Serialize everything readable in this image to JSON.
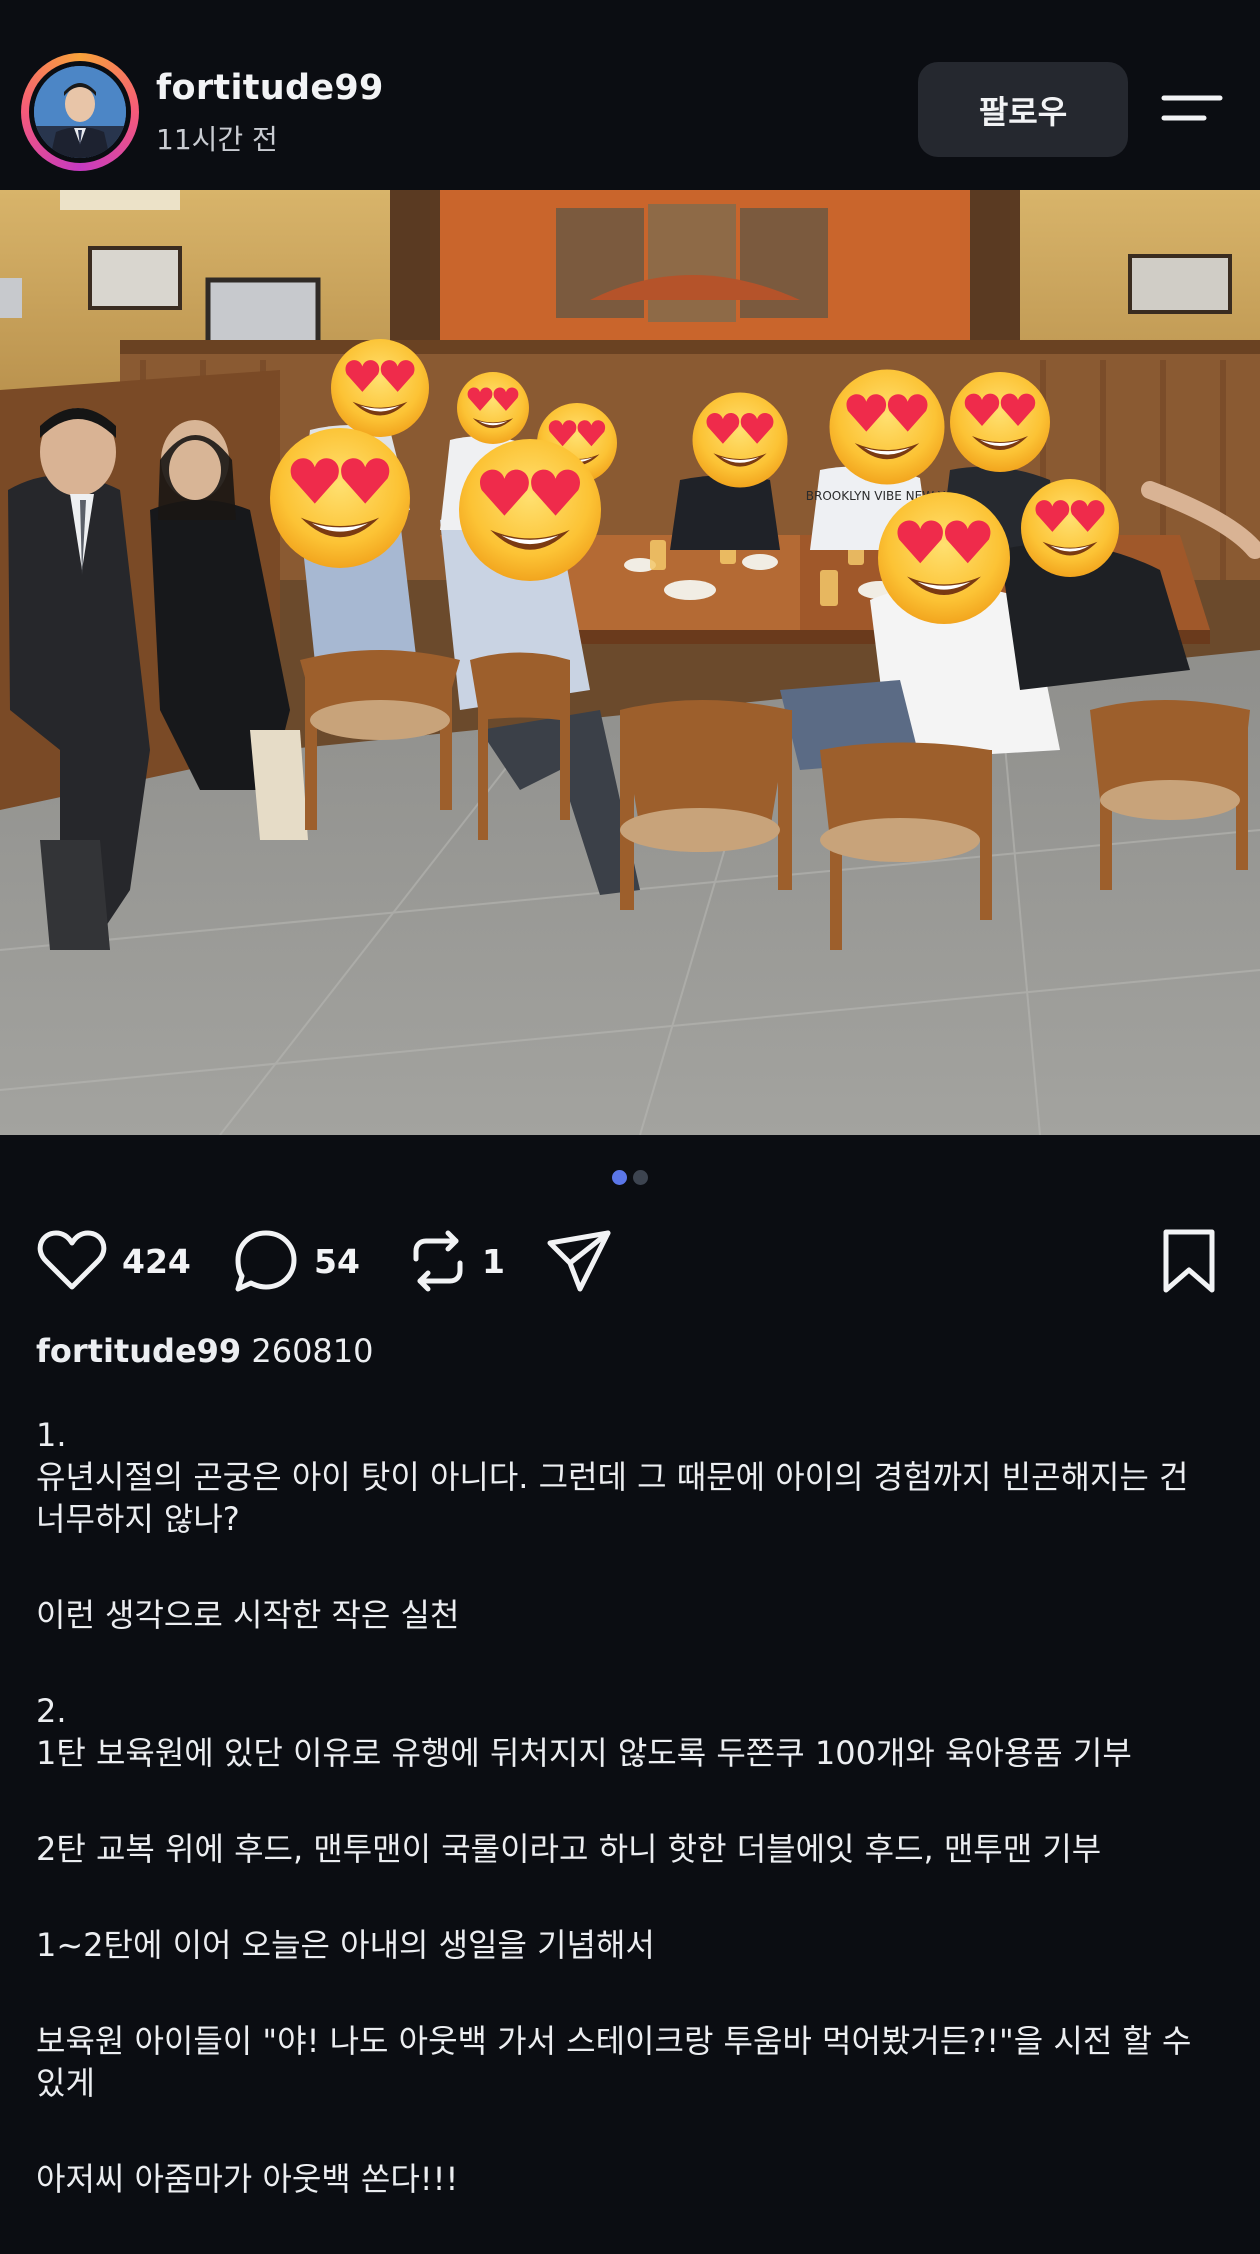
{
  "post": {
    "username": "fortitude99",
    "time_ago": "11시간 전",
    "follow_label": "팔로우"
  },
  "carousel": {
    "total": 2,
    "current": 1
  },
  "actions": {
    "likes": "424",
    "comments": "54",
    "reposts": "1"
  },
  "caption": {
    "username": "fortitude99",
    "code": "260810",
    "paragraphs": [
      "1.\n유년시절의 곤궁은 아이 탓이 아니다. 그런데 그 때문에 아이의 경험까지 빈곤해지는 건 너무하지 않나?",
      "이런 생각으로 시작한 작은 실천",
      "2.\n1탄 보육원에 있단 이유로 유행에 뒤처지지 않도록 두쫀쿠 100개와 육아용품 기부",
      "2탄 교복 위에 후드, 맨투맨이 국룰이라고 하니 핫한 더블에잇 후드, 맨투맨 기부",
      "1~2탄에 이어 오늘은 아내의 생일을 기념해서",
      "보육원 아이들이 \"야! 나도 아웃백 가서 스테이크랑 투움바 먹어봤거든?!\"을 시전 할 수 있게",
      "아저씨 아줌마가 아웃백 쏜다!!!"
    ]
  },
  "photo": {
    "shirt_text": "BROOKLYN VIBE NEW YORK"
  },
  "colors": {
    "background": "#0b0d12",
    "button_bg": "#25282f",
    "dot_active": "#5b76e8",
    "dot_inactive": "#3d4450",
    "text": "#f2f3f5"
  },
  "icons": [
    "hamburger-menu-icon",
    "heart-icon",
    "comment-icon",
    "repost-icon",
    "send-icon",
    "bookmark-icon"
  ]
}
